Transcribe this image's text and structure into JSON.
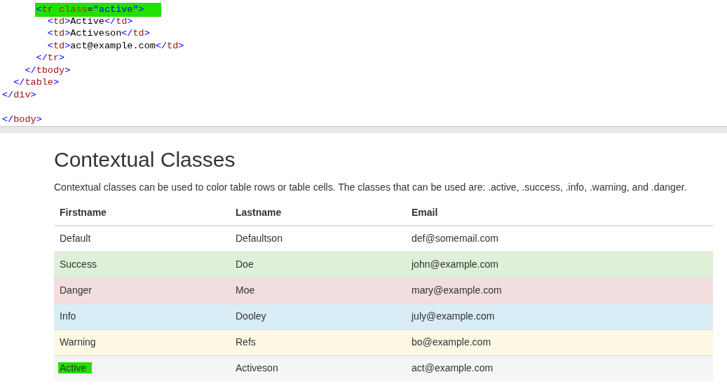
{
  "code_editor": {
    "lines": [
      {
        "text": "      <tr class=\"active\">",
        "highlighted": true
      },
      {
        "text": "        <td>Active</td>",
        "highlighted": false
      },
      {
        "text": "        <td>Activeson</td>",
        "highlighted": false
      },
      {
        "text": "        <td>act@example.com</td>",
        "highlighted": false
      },
      {
        "text": "      </tr>",
        "highlighted": false
      },
      {
        "text": "    </tbody>",
        "highlighted": false
      },
      {
        "text": "  </table>",
        "highlighted": false
      },
      {
        "text": "</div>",
        "highlighted": false
      },
      {
        "kind": "blank"
      },
      {
        "text": "</body>",
        "highlighted": false
      }
    ]
  },
  "preview": {
    "heading": "Contextual Classes",
    "description": "Contextual classes can be used to color table rows or table cells. The classes that can be used are: .active, .success, .info, .warning, and .danger.",
    "table": {
      "columns": [
        "Firstname",
        "Lastname",
        "Email"
      ],
      "rows": [
        {
          "kind": "default",
          "cells": [
            {
              "text": "Default",
              "highlighted": false
            },
            {
              "text": "Defaultson",
              "highlighted": false
            },
            {
              "text": "def@somemail.com",
              "highlighted": false
            }
          ]
        },
        {
          "kind": "success",
          "cells": [
            {
              "text": "Success",
              "highlighted": false
            },
            {
              "text": "Doe",
              "highlighted": false
            },
            {
              "text": "john@example.com",
              "highlighted": false
            }
          ]
        },
        {
          "kind": "danger",
          "cells": [
            {
              "text": "Danger",
              "highlighted": false
            },
            {
              "text": "Moe",
              "highlighted": false
            },
            {
              "text": "mary@example.com",
              "highlighted": false
            }
          ]
        },
        {
          "kind": "info",
          "cells": [
            {
              "text": "Info",
              "highlighted": false
            },
            {
              "text": "Dooley",
              "highlighted": false
            },
            {
              "text": "july@example.com",
              "highlighted": false
            }
          ]
        },
        {
          "kind": "warning",
          "cells": [
            {
              "text": "Warning",
              "highlighted": false
            },
            {
              "text": "Refs",
              "highlighted": false
            },
            {
              "text": "bo@example.com",
              "highlighted": false
            }
          ]
        },
        {
          "kind": "active",
          "cells": [
            {
              "text": "Active",
              "highlighted": true
            },
            {
              "text": "Activeson",
              "highlighted": false
            },
            {
              "text": "act@example.com",
              "highlighted": false
            }
          ]
        }
      ]
    }
  }
}
